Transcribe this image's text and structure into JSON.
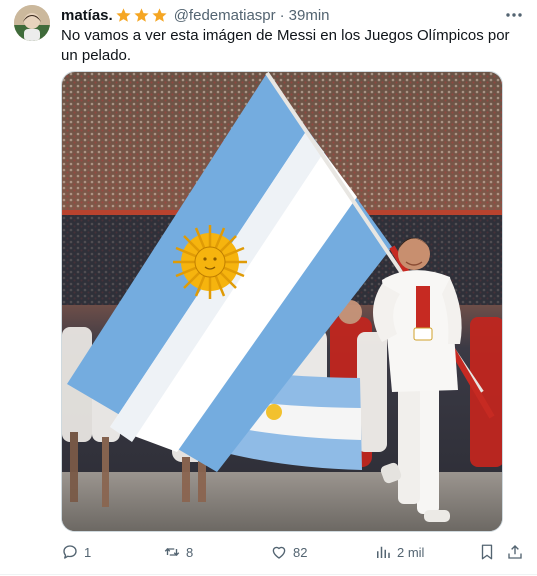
{
  "author": {
    "display_name": "matías.",
    "handle": "@fedematiaspr",
    "time": "39min",
    "badges": [
      "star-icon",
      "star-icon",
      "star-icon"
    ]
  },
  "tweet": {
    "text": "No vamos a ver esta imágen de Messi en los Juegos Olímpicos por un pelado."
  },
  "actions": {
    "replies": "1",
    "reposts": "8",
    "likes": "82",
    "views": "2 mil"
  },
  "icons": {
    "more": "more-dots-icon",
    "reply": "reply-bubble-icon",
    "repost": "repost-arrows-icon",
    "like": "heart-icon",
    "views": "bar-chart-icon",
    "bookmark": "bookmark-icon",
    "share": "share-upload-icon"
  },
  "colors": {
    "text": "#0f1419",
    "secondary": "#536471",
    "star": "#f5a623",
    "flag_blue": "#74acdf",
    "flag_sun": "#f6b40e"
  }
}
